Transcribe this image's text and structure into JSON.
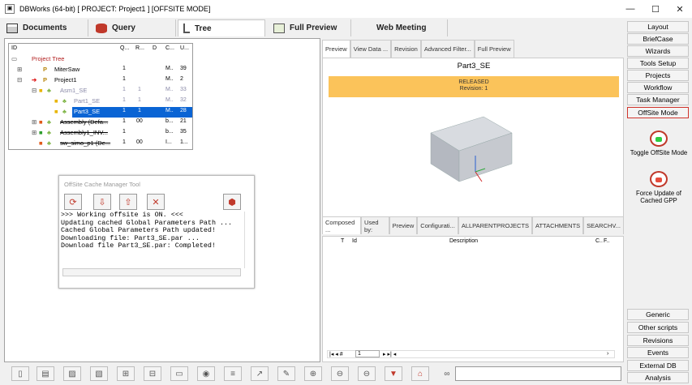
{
  "window": {
    "title": "DBWorks (64-bit) [ PROJECT: Project1 ] [OFFSITE MODE]",
    "minimize": "—",
    "maximize": "☐",
    "close": "✕"
  },
  "toptabs": [
    {
      "label": "Documents",
      "icon": "documents-icon"
    },
    {
      "label": "Query",
      "icon": "database-icon"
    },
    {
      "label": "Tree",
      "icon": "tree-icon"
    },
    {
      "label": "Full Preview",
      "icon": "preview-icon"
    },
    {
      "label": "Web Meeting",
      "icon": ""
    }
  ],
  "tree": {
    "headers": [
      "ID",
      "Q...",
      "R...",
      "D",
      "C...",
      "U..."
    ],
    "rows": [
      {
        "name": "Project Tree",
        "q": "",
        "r": "",
        "d": "",
        "c": "",
        "u": ""
      },
      {
        "name": "MiterSaw",
        "q": "1",
        "r": "",
        "d": "",
        "c": "M..",
        "u": "39"
      },
      {
        "name": "Project1",
        "q": "1",
        "r": "",
        "d": "",
        "c": "M..",
        "u": "2"
      },
      {
        "name": "Asm1_SE",
        "q": "1",
        "r": "1",
        "d": "",
        "c": "M..",
        "u": "33"
      },
      {
        "name": "Part1_SE",
        "q": "1",
        "r": "1",
        "d": "",
        "c": "M..",
        "u": "32"
      },
      {
        "name": "Part3_SE",
        "q": "1",
        "r": "1",
        "d": "",
        "c": "M..",
        "u": "28"
      },
      {
        "name": "Assembly (Defa...",
        "q": "1",
        "r": "00",
        "d": "",
        "c": "b...",
        "u": "21"
      },
      {
        "name": "Assembly1_INV...",
        "q": "1",
        "r": "",
        "d": "",
        "c": "b...",
        "u": "35"
      },
      {
        "name": "sw_simo_p1 (De...",
        "q": "1",
        "r": "00",
        "d": "",
        "c": "I...",
        "u": "1..."
      }
    ]
  },
  "cache": {
    "title": "OffSite Cache Manager Tool",
    "log": ">>> Working offsite is ON. <<<\nUpdating cached Global Parameters Path ...\nCached Global Parameters Path updated!\nDownloading file: Part3_SE.par ...\nDownload file Part3_SE.par: Completed!"
  },
  "preview": {
    "tabs": [
      "Preview",
      "View Data ...",
      "Revision",
      "Advanced Filter...",
      "Full Preview"
    ],
    "title": "Part3_SE",
    "status": "RELEASED",
    "revision": "Revision: 1"
  },
  "lower": {
    "tabs": [
      "Composed ...",
      "Used by:",
      "Preview",
      "Configurati...",
      "ALLPARENTPROJECTS",
      "ATTACHMENTS",
      "SEARCHV..."
    ],
    "headers": [
      "T",
      "Id",
      "Description",
      "C..",
      "F.."
    ],
    "page": "1"
  },
  "sidebar": {
    "top": [
      "Layout",
      "BriefCase",
      "Wizards",
      "Tools Setup",
      "Projects",
      "Workflow",
      "Task Manager",
      "OffSite Mode"
    ],
    "toggle_label": "Toggle OffSite Mode",
    "force_label": "Force Update of Cached GPP",
    "bottom": [
      "Generic",
      "Other scripts",
      "Revisions",
      "Events",
      "External DB",
      "Analysis"
    ]
  },
  "colors": {
    "accent": "#0a64d4",
    "banner": "#fbc35a",
    "highlight": "#d0342c"
  }
}
